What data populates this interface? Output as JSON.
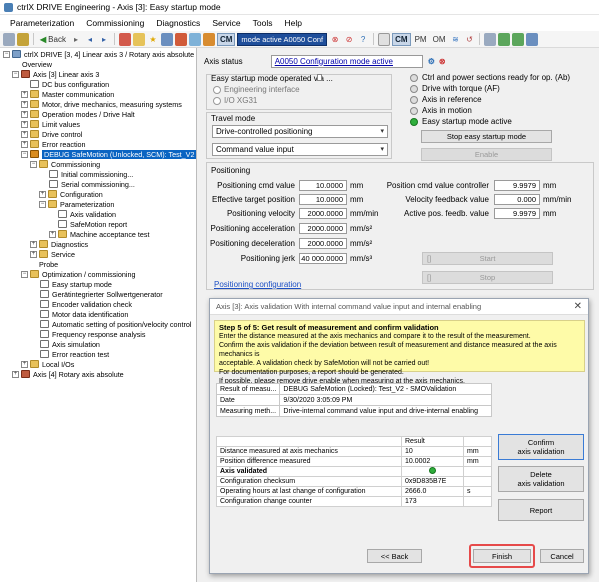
{
  "window": {
    "title": "ctrlX DRIVE Engineering - Axis [3]: Easy startup mode"
  },
  "menu": [
    "Parameterization",
    "Commissioning",
    "Diagnostics",
    "Service",
    "Tools",
    "Help"
  ],
  "toolbar": {
    "back_label": "Back",
    "cm_label": "CM",
    "mode_label": "mode active  A0050 Conf",
    "cm2_label": "CM",
    "pm_label": "PM",
    "om_label": "OM"
  },
  "tree": {
    "root": "ctrlX DRIVE [3, 4] Linear axis 3 / Rotary axis absolute",
    "overview": "Overview",
    "axis3": "Axis [3] Linear axis 3",
    "dc_bus": "DC bus configuration",
    "master_comm": "Master communication",
    "motor_mech": "Motor, drive mechanics, measuring systems",
    "op_modes": "Operation modes / Drive Halt",
    "limit_values": "Limit values",
    "drive_control": "Drive control",
    "error_reaction": "Error reaction",
    "debug": "DEBUG SafeMotion (Unlocked, SCM): Test_V2",
    "commissioning": "Commissioning",
    "initial_comm": "Initial commissioning...",
    "serial_comm": "Serial commissioning...",
    "configuration": "Configuration",
    "parameterization": "Parameterization",
    "axis_validation": "Axis validation",
    "safemotion_report": "SafeMotion report",
    "machine_accept": "Machine acceptance test",
    "diagnostics": "Diagnostics",
    "service": "Service",
    "probe": "Probe",
    "optimization": "Optimization / commissioning",
    "easy_startup": "Easy startup mode",
    "device_setpoint": "Gerätintegrierter Sollwertgenerator",
    "encoder_check": "Encoder validation check",
    "motor_data_id": "Motor data identification",
    "auto_setting": "Automatic setting of position/velocity control",
    "freq_analysis": "Frequency response analysis",
    "axis_sim": "Axis simulation",
    "error_test": "Error reaction test",
    "local_io": "Local I/Os",
    "axis4": "Axis [4] Rotary axis absolute"
  },
  "main": {
    "axis_status_label": "Axis status",
    "axis_status_value": "A0050 Configuration mode active",
    "operated_via_label": "Easy startup mode operated via ...",
    "radio_engineering": "Engineering interface",
    "radio_io": "I/O XG31",
    "travel_mode_label": "Travel mode",
    "travel_select": "Drive-controlled positioning",
    "cmd_select": "Command value input",
    "leds": [
      "Ctrl and power sections ready for op. (Ab)",
      "Drive with torque (AF)",
      "Axis in reference",
      "Axis in motion",
      "Easy startup mode active"
    ],
    "stop_btn": "Stop easy startup mode",
    "enable_btn": "Enable",
    "positioning_label": "Positioning",
    "rows": [
      {
        "label": "Positioning cmd value",
        "value": "10.0000",
        "unit": "mm"
      },
      {
        "label": "Effective target position",
        "value": "10.0000",
        "unit": "mm"
      },
      {
        "label": "Positioning velocity",
        "value": "2000.0000",
        "unit": "mm/min"
      },
      {
        "label": "Positioning acceleration",
        "value": "2000.0000",
        "unit": "mm/s²"
      },
      {
        "label": "Positioning deceleration",
        "value": "2000.0000",
        "unit": "mm/s²"
      },
      {
        "label": "Positioning jerk",
        "value": "40 000.0000",
        "unit": "mm/s³"
      }
    ],
    "right_rows": [
      {
        "label": "Position cmd value controller",
        "value": "9.9979",
        "unit": "mm"
      },
      {
        "label": "Velocity feedback value",
        "value": "0.000",
        "unit": "mm/min"
      },
      {
        "label": "Active pos. feedb. value",
        "value": "9.9979",
        "unit": "mm"
      }
    ],
    "start_btn": "Start",
    "stop2_btn": "Stop",
    "pos_config_link": "Positioning configuration"
  },
  "dialog": {
    "title": "Axis [3]: Axis validation With internal command value input and internal enabling",
    "step_head": "Step 5 of 5: Get result of measurement and confirm validation",
    "step_lines": [
      "Enter the distance measured at the axis mechanics and compare it to the result of the measurement.",
      "Confirm the axis validation if the deviation between result of measurement and distance measured at the axis mechanics is",
      "acceptable. A validation check by SafeMotion will not be carried out!",
      "For documentation purposes, a report should be generated.",
      "If possible, please remove drive enable when measuring at the axis mechanics."
    ],
    "info": [
      {
        "k": "Result of measu...",
        "v": "DEBUG SafeMotion (Locked): Test_V2 - SMOValidation"
      },
      {
        "k": "Date",
        "v": "9/30/2020 3:05:09 PM"
      },
      {
        "k": "Measuring meth...",
        "v": "Drive-internal command value input and drive-internal enabling"
      }
    ],
    "result_header": "Result",
    "results": [
      {
        "label": "Distance measured at axis mechanics",
        "value": "10",
        "unit": "mm"
      },
      {
        "label": "Position difference measured",
        "value": "10.0002",
        "unit": "mm"
      },
      {
        "label": "Axis validated",
        "value": "",
        "unit": ""
      },
      {
        "label": "Configuration checksum",
        "value": "0x9D835B7E",
        "unit": ""
      },
      {
        "label": "Operating hours at last change of configuration",
        "value": "2666.0",
        "unit": "s"
      },
      {
        "label": "Configuration change counter",
        "value": "173",
        "unit": ""
      }
    ],
    "confirm_btn": "Confirm\naxis validation",
    "delete_btn": "Delete\naxis validation",
    "report_btn": "Report",
    "back_btn": "<< Back",
    "finish_btn": "Finish",
    "cancel_btn": "Cancel"
  }
}
